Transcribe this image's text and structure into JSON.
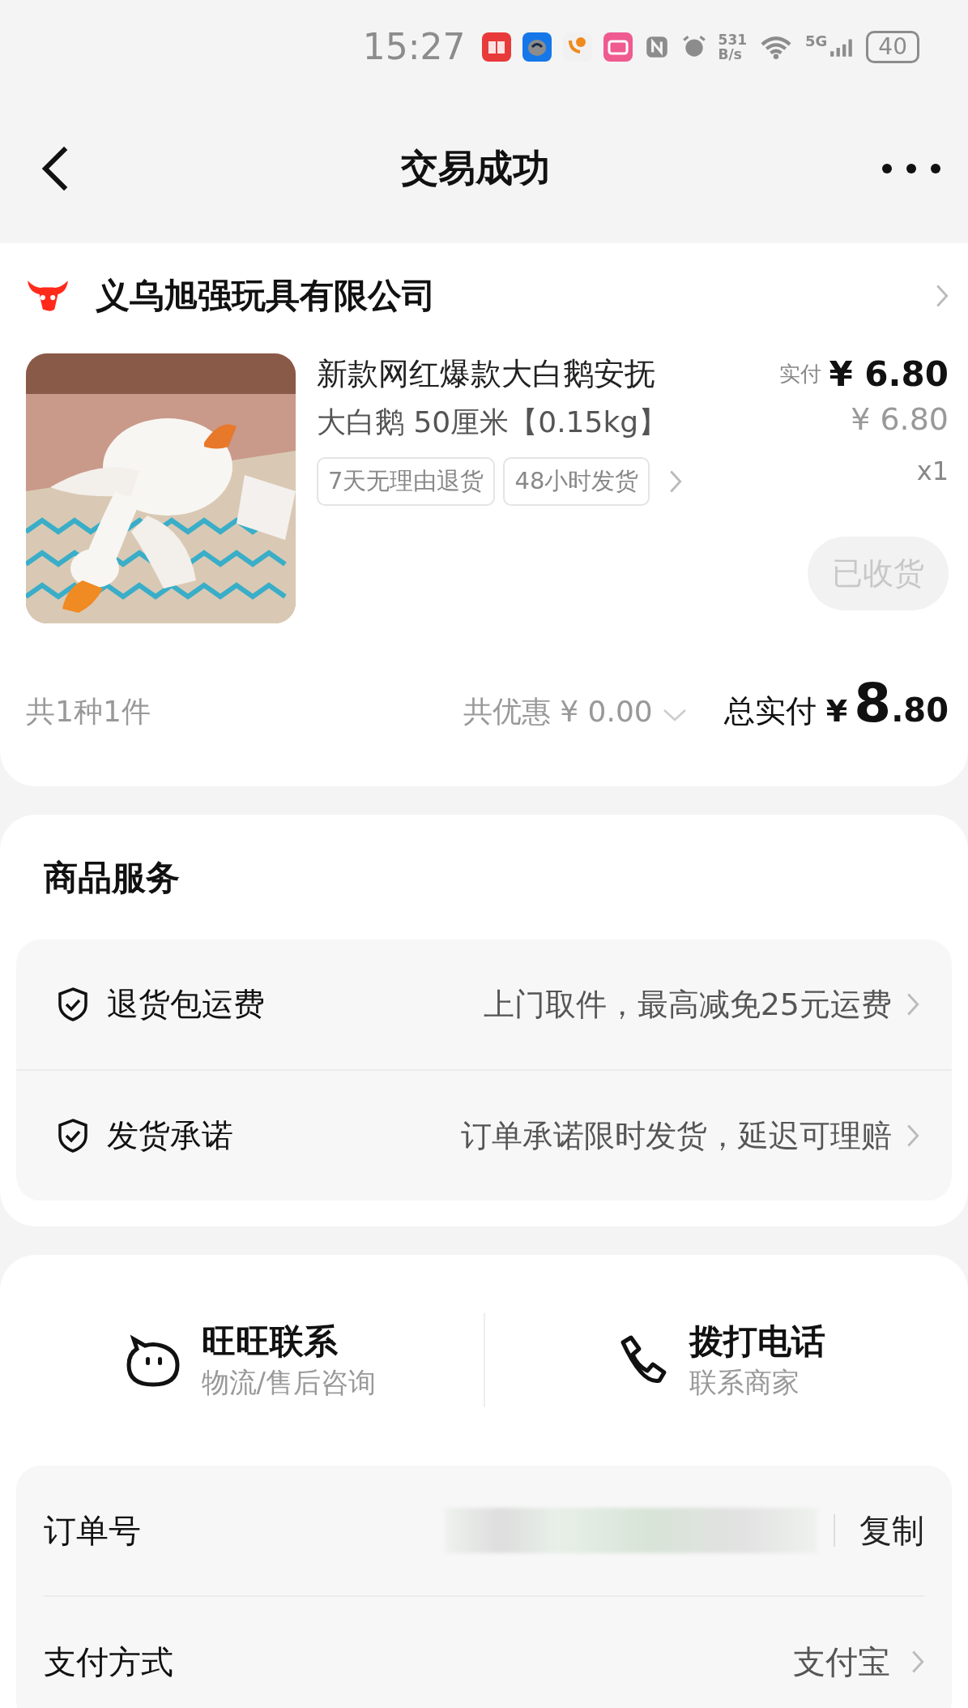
{
  "status_bar": {
    "time": "15:27",
    "net_speed": "531",
    "net_unit": "B/s",
    "network": "5G",
    "battery": "40"
  },
  "nav": {
    "title": "交易成功"
  },
  "shop": {
    "name": "义乌旭强玩具有限公司"
  },
  "product": {
    "kind": "picture",
    "title": "新款网红爆款大白鹅安抚",
    "spec": "大白鹅 50厘米【0.15kg】",
    "tags": [
      "7天无理由退货",
      "48小时发货"
    ],
    "paid_label": "实付",
    "paid": "¥ 6.80",
    "price": "¥ 6.80",
    "qty": "x1",
    "status_button": {
      "label": "已收货",
      "disabled": true
    }
  },
  "summary": {
    "count": "共1种1件",
    "discount": "共优惠 ¥ 0.00",
    "total_label": "总实付",
    "total_currency": "¥",
    "total_int": "8",
    "total_dec": ".80"
  },
  "services": {
    "title": "商品服务",
    "items": [
      {
        "name": "退货包运费",
        "desc": "上门取件，最高减免25元运费"
      },
      {
        "name": "发货承诺",
        "desc": "订单承诺限时发货，延迟可理赔"
      }
    ]
  },
  "contacts": [
    {
      "kind": "chat",
      "title": "旺旺联系",
      "subtitle": "物流/售后咨询"
    },
    {
      "kind": "phone",
      "title": "拨打电话",
      "subtitle": "联系商家"
    }
  ],
  "order_info": [
    {
      "kind": "copy",
      "label": "订单号",
      "action": "复制"
    },
    {
      "kind": "link",
      "label": "支付方式",
      "value": "支付宝"
    }
  ]
}
